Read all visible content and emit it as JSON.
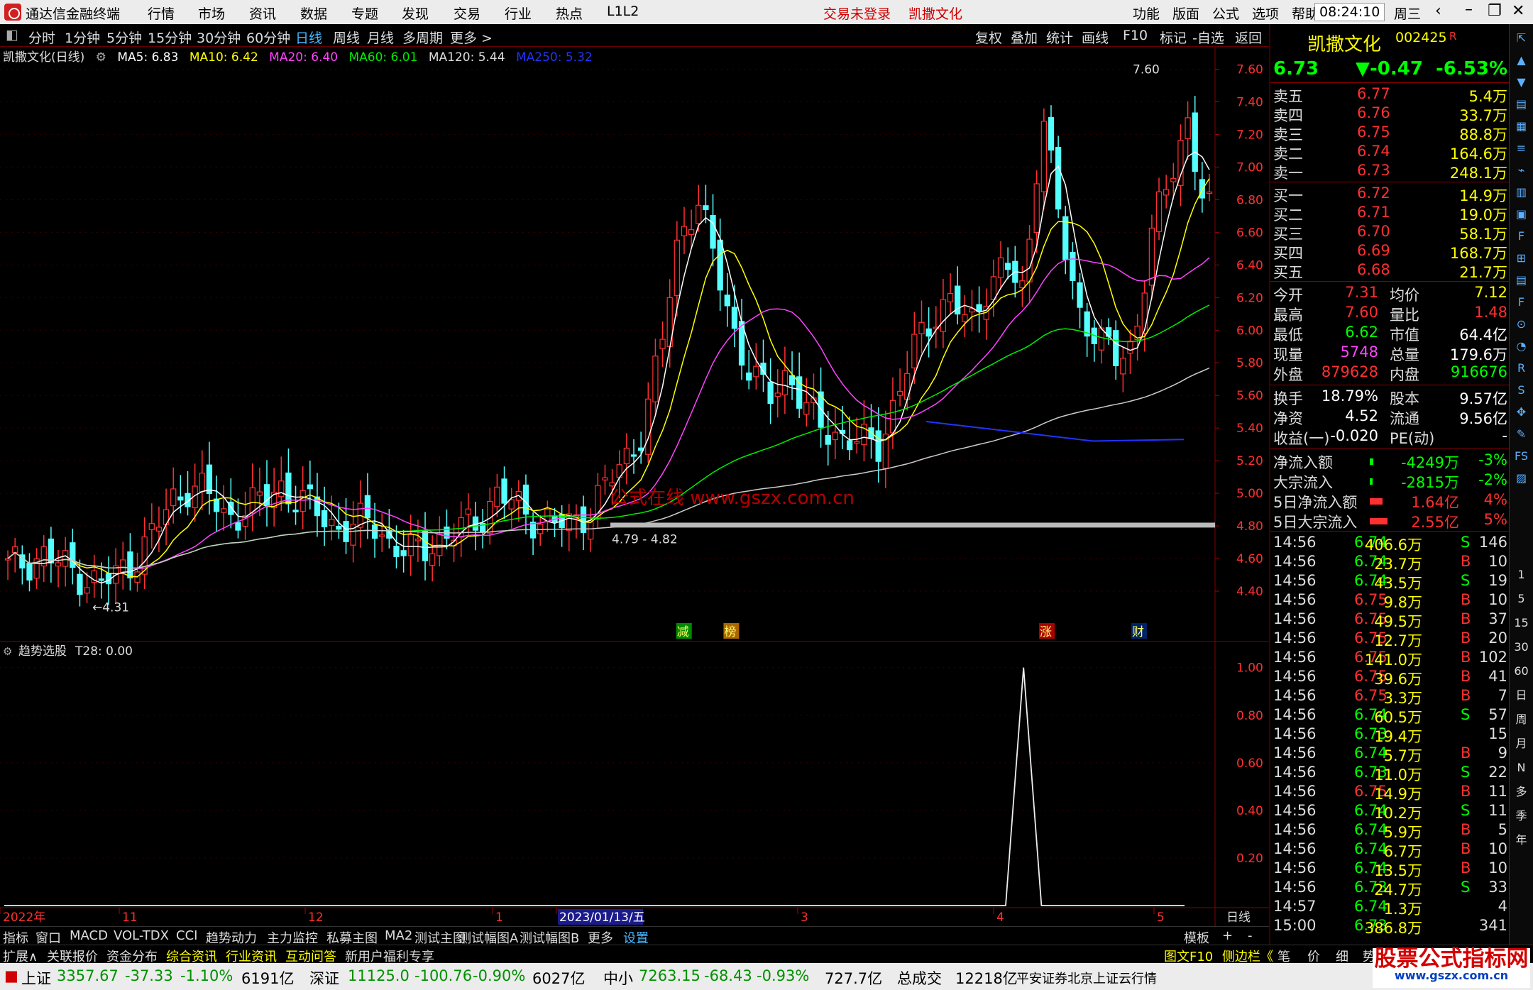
{
  "titlebar": {
    "app_name": "通达信金融终端",
    "menus": [
      "行情",
      "市场",
      "资讯",
      "数据",
      "专题",
      "发现",
      "交易",
      "行业",
      "热点",
      "L1L2"
    ],
    "login_status": "交易未登录",
    "stock_name": "凯撒文化",
    "right_menus": [
      "功能",
      "版面",
      "公式",
      "选项",
      "帮助"
    ],
    "time": "08:24:10",
    "weekday": "周三"
  },
  "periods": [
    "分时",
    "1分钟",
    "5分钟",
    "15分钟",
    "30分钟",
    "60分钟",
    "日线",
    "周线",
    "月线",
    "多周期",
    "更多 >"
  ],
  "active_period": "日线",
  "chart_tools": [
    "复权",
    "叠加",
    "统计",
    "画线",
    "F10",
    "标记",
    "-自选",
    "返回"
  ],
  "main_chart": {
    "title": "凯撒文化(日线)",
    "ma": [
      {
        "label": "MA5: 6.83",
        "color": "#ffffff"
      },
      {
        "label": "MA10: 6.42",
        "color": "#ffff00"
      },
      {
        "label": "MA20: 6.40",
        "color": "#ff44ff"
      },
      {
        "label": "MA60: 6.01",
        "color": "#00ee00"
      },
      {
        "label": "MA120: 5.44",
        "color": "#dddddd"
      },
      {
        "label": "MA250: 5.32",
        "color": "#2233ff"
      }
    ],
    "price_labels": [
      "7.60",
      "7.40",
      "7.20",
      "7.00",
      "6.80",
      "6.60",
      "6.40",
      "6.20",
      "6.00",
      "5.80",
      "5.60",
      "5.40",
      "5.20",
      "5.00",
      "4.80",
      "4.60",
      "4.40"
    ],
    "annotations": {
      "high": "7.60",
      "low": "4.31",
      "zone": "4.79 - 4.82"
    },
    "watermark": "公式在线 www.gszx.com.cn",
    "event_tags": [
      {
        "text": "减",
        "bg": "#008800",
        "pos": 0.563
      },
      {
        "text": "榜",
        "bg": "#aa6600",
        "pos": 0.602
      },
      {
        "text": "涨",
        "bg": "#aa0000",
        "pos": 0.862
      },
      {
        "text": "财",
        "bg": "#002266",
        "pos": 0.938
      }
    ]
  },
  "sub_chart": {
    "title": "趋势选股",
    "value_label": "T28: 0.00",
    "axis_labels": [
      "1.00",
      "0.80",
      "0.60",
      "0.40",
      "0.20"
    ]
  },
  "x_axis": {
    "labels": [
      "2022年",
      "11",
      "12",
      "1",
      "2023/01/13/五",
      "3",
      "4",
      "5"
    ],
    "right_label": "日线"
  },
  "chart_data": [
    {
      "type": "candlestick",
      "title": "凯撒文化(日线)",
      "y_range": [
        4.3,
        7.65
      ],
      "x_range": [
        "2022-10",
        "2023-05"
      ],
      "description_series": [
        {
          "name": "MA5",
          "value": 6.83
        },
        {
          "name": "MA10",
          "value": 6.42
        },
        {
          "name": "MA20",
          "value": 6.4
        },
        {
          "name": "MA60",
          "value": 6.01
        },
        {
          "name": "MA120",
          "value": 5.44
        },
        {
          "name": "MA250",
          "value": 5.32
        }
      ],
      "close_path": [
        4.55,
        4.58,
        4.62,
        4.56,
        4.5,
        4.44,
        4.5,
        4.6,
        4.75,
        4.95,
        5.05,
        5.0,
        4.85,
        4.9,
        4.95,
        5.05,
        4.95,
        4.9,
        4.8,
        4.78,
        4.85,
        4.7,
        4.62,
        4.68,
        4.72,
        4.78,
        4.85,
        5.0,
        4.92,
        4.85,
        4.82,
        4.8,
        4.9,
        5.05,
        5.2,
        5.4,
        5.9,
        6.6,
        6.8,
        6.4,
        6.0,
        5.7,
        5.6,
        5.75,
        5.5,
        5.4,
        5.35,
        5.3,
        5.3,
        5.6,
        5.9,
        6.1,
        6.2,
        6.0,
        6.3,
        6.4,
        6.2,
        7.4,
        6.6,
        6.1,
        6.0,
        5.8,
        5.9,
        6.6,
        6.9,
        7.3,
        6.73
      ],
      "high": 7.6,
      "low": 4.31
    },
    {
      "type": "line",
      "title": "趋势选股",
      "series": [
        {
          "name": "T28",
          "values": [
            0,
            0,
            0,
            0,
            0,
            0,
            0,
            0,
            0,
            0,
            0,
            0,
            0,
            0,
            0,
            0,
            0,
            0,
            0,
            0,
            0,
            0,
            0,
            0,
            0,
            0,
            0,
            0,
            0,
            0,
            0,
            0,
            0,
            0,
            0,
            0,
            0,
            0,
            0,
            0,
            0,
            0,
            0,
            0,
            0,
            0,
            0,
            0,
            0,
            0,
            0,
            0,
            0,
            0,
            0,
            0,
            0,
            1,
            0,
            0,
            0,
            0,
            0,
            0,
            0,
            0,
            0
          ]
        }
      ],
      "ylim": [
        0,
        1.0
      ]
    }
  ],
  "quote": {
    "name": "凯撒文化",
    "code": "002425",
    "badge": "R",
    "price": "6.73",
    "change": "▼-0.47",
    "pct": "-6.53%",
    "asks": [
      {
        "label": "卖五",
        "price": "6.77",
        "vol": "5.4万"
      },
      {
        "label": "卖四",
        "price": "6.76",
        "vol": "33.7万"
      },
      {
        "label": "卖三",
        "price": "6.75",
        "vol": "88.8万"
      },
      {
        "label": "卖二",
        "price": "6.74",
        "vol": "164.6万"
      },
      {
        "label": "卖一",
        "price": "6.73",
        "vol": "248.1万"
      }
    ],
    "bids": [
      {
        "label": "买一",
        "price": "6.72",
        "vol": "14.9万"
      },
      {
        "label": "买二",
        "price": "6.71",
        "vol": "19.0万"
      },
      {
        "label": "买三",
        "price": "6.70",
        "vol": "58.1万"
      },
      {
        "label": "买四",
        "price": "6.69",
        "vol": "168.7万"
      },
      {
        "label": "买五",
        "price": "6.68",
        "vol": "21.7万"
      }
    ],
    "stats": [
      {
        "l1": "今开",
        "v1": "7.31",
        "c1": "#ff3030",
        "l2": "均价",
        "v2": "7.12",
        "c2": "#ffff00"
      },
      {
        "l1": "最高",
        "v1": "7.60",
        "c1": "#ff3030",
        "l2": "量比",
        "v2": "1.48",
        "c2": "#ff3030"
      },
      {
        "l1": "最低",
        "v1": "6.62",
        "c1": "#00ff00",
        "l2": "市值",
        "v2": "64.4亿",
        "c2": "#ffffff"
      },
      {
        "l1": "现量",
        "v1": "5748",
        "c1": "#ff44ff",
        "l2": "总量",
        "v2": "179.6万",
        "c2": "#ffffff"
      },
      {
        "l1": "外盘",
        "v1": "879628",
        "c1": "#ff3030",
        "l2": "内盘",
        "v2": "916676",
        "c2": "#00ff00"
      }
    ],
    "stats2": [
      {
        "l1": "换手",
        "v1": "18.79%",
        "c1": "#ffffff",
        "l2": "股本",
        "v2": "9.57亿",
        "c2": "#ffffff"
      },
      {
        "l1": "净资",
        "v1": "4.52",
        "c1": "#ffffff",
        "l2": "流通",
        "v2": "9.56亿",
        "c2": "#ffffff"
      },
      {
        "l1": "收益(一)",
        "v1": "-0.020",
        "c1": "#ffffff",
        "l2": "PE(动)",
        "v2": "-",
        "c2": "#ffffff"
      }
    ],
    "flows": [
      {
        "label": "净流入额",
        "value": "-4249万",
        "pct": "-3%",
        "color": "#00ff00",
        "bar": 0.08
      },
      {
        "label": "大宗流入",
        "value": "-2815万",
        "pct": "-2%",
        "color": "#00ff00",
        "bar": 0.06
      },
      {
        "label": "5日净流入额",
        "value": "1.64亿",
        "pct": "4%",
        "color": "#ff3030",
        "bar": 0.7
      },
      {
        "label": "5日大宗流入",
        "value": "2.55亿",
        "pct": "5%",
        "color": "#ff3030",
        "bar": 1.0
      }
    ],
    "ticks": [
      {
        "time": "14:56",
        "price": "6.74",
        "vol": "406.6万",
        "side": "S",
        "num": "146"
      },
      {
        "time": "14:56",
        "price": "6.74",
        "vol": "23.7万",
        "side": "B",
        "num": "10"
      },
      {
        "time": "14:56",
        "price": "6.74",
        "vol": "43.5万",
        "side": "S",
        "num": "19"
      },
      {
        "time": "14:56",
        "price": "6.75",
        "vol": "9.8万",
        "side": "B",
        "num": "10"
      },
      {
        "time": "14:56",
        "price": "6.75",
        "vol": "49.5万",
        "side": "B",
        "num": "37"
      },
      {
        "time": "14:56",
        "price": "6.75",
        "vol": "12.7万",
        "side": "B",
        "num": "20"
      },
      {
        "time": "14:56",
        "price": "6.75",
        "vol": "141.0万",
        "side": "B",
        "num": "102"
      },
      {
        "time": "14:56",
        "price": "6.75",
        "vol": "39.6万",
        "side": "B",
        "num": "41"
      },
      {
        "time": "14:56",
        "price": "6.75",
        "vol": "3.3万",
        "side": "B",
        "num": "7"
      },
      {
        "time": "14:56",
        "price": "6.74",
        "vol": "60.5万",
        "side": "S",
        "num": "57"
      },
      {
        "time": "14:56",
        "price": "6.73",
        "vol": "19.4万",
        "side": "",
        "num": "15"
      },
      {
        "time": "14:56",
        "price": "6.74",
        "vol": "5.7万",
        "side": "B",
        "num": "9"
      },
      {
        "time": "14:56",
        "price": "6.73",
        "vol": "11.0万",
        "side": "S",
        "num": "22"
      },
      {
        "time": "14:56",
        "price": "6.75",
        "vol": "14.9万",
        "side": "B",
        "num": "11"
      },
      {
        "time": "14:56",
        "price": "6.74",
        "vol": "10.2万",
        "side": "S",
        "num": "11"
      },
      {
        "time": "14:56",
        "price": "6.74",
        "vol": "5.9万",
        "side": "B",
        "num": "5"
      },
      {
        "time": "14:56",
        "price": "6.74",
        "vol": "6.7万",
        "side": "B",
        "num": "10"
      },
      {
        "time": "14:56",
        "price": "6.74",
        "vol": "13.5万",
        "side": "B",
        "num": "10"
      },
      {
        "time": "14:56",
        "price": "6.73",
        "vol": "24.7万",
        "side": "S",
        "num": "33"
      },
      {
        "time": "14:57",
        "price": "6.74",
        "vol": "1.3万",
        "side": "",
        "num": "4"
      },
      {
        "time": "15:00",
        "price": "6.73",
        "vol": "386.8万",
        "side": "",
        "num": "341"
      }
    ]
  },
  "bottom_tabs": [
    "指标",
    "窗口",
    "MACD",
    "VOL-TDX",
    "CCI",
    "趋势动力",
    "主力监控",
    "私募主图",
    "MA2",
    "测试主图",
    "测试幅图A",
    "测试幅图B",
    "更多",
    "设置"
  ],
  "bottom_right": [
    "模板",
    "+",
    "-"
  ],
  "info_tabs": [
    "扩展∧",
    "关联报价",
    "资金分布",
    "综合资讯",
    "行业资讯",
    "互动问答",
    "新用户福利专享"
  ],
  "info_tabs_colors": [
    "#dddddd",
    "#dddddd",
    "#dddddd",
    "#ffff00",
    "#ffff00",
    "#ffff00",
    "#dddddd"
  ],
  "info_right": [
    "图文F10",
    "侧边栏《",
    "笔",
    "价",
    "细",
    "势"
  ],
  "status": {
    "sh_label": "上证",
    "sh_val": "3357.67",
    "sh_chg": "-37.33",
    "sh_pct": "-1.10%",
    "sh_amt": "6191亿",
    "sz_label": "深证",
    "sz_val": "11125.0",
    "sz_chg": "-100.76",
    "sz_pct": "-0.90%",
    "sz_amt": "6027亿",
    "zx_label": "中小",
    "zx_val": "7263.15",
    "zx_chg": "-68.43",
    "zx_pct": "-0.93%",
    "zx_amt": "727.7亿",
    "total_label": "总成交",
    "total_val": "12218亿",
    "broker": "平安证券北京上证云行情"
  },
  "banner": {
    "title": "股票公式指标网",
    "url": "www.gszx.com.cn"
  },
  "sidebar_icons": [
    "expand-icon",
    "up-arrow-icon",
    "down-arrow-icon",
    "news-icon",
    "chart-icon",
    "list-icon",
    "line-chart-icon",
    "candle-icon",
    "report-icon",
    "f10-icon",
    "grid-icon",
    "doc-icon",
    "f-icon",
    "settings-icon",
    "pie-icon",
    "rsi-icon",
    "s-icon",
    "move-icon",
    "pen-icon",
    "fs-icon",
    "chart2-icon"
  ],
  "sidebar_periods": [
    "1",
    "5",
    "15",
    "30",
    "60",
    "日",
    "周",
    "月",
    "N",
    "多",
    "季",
    "年"
  ]
}
